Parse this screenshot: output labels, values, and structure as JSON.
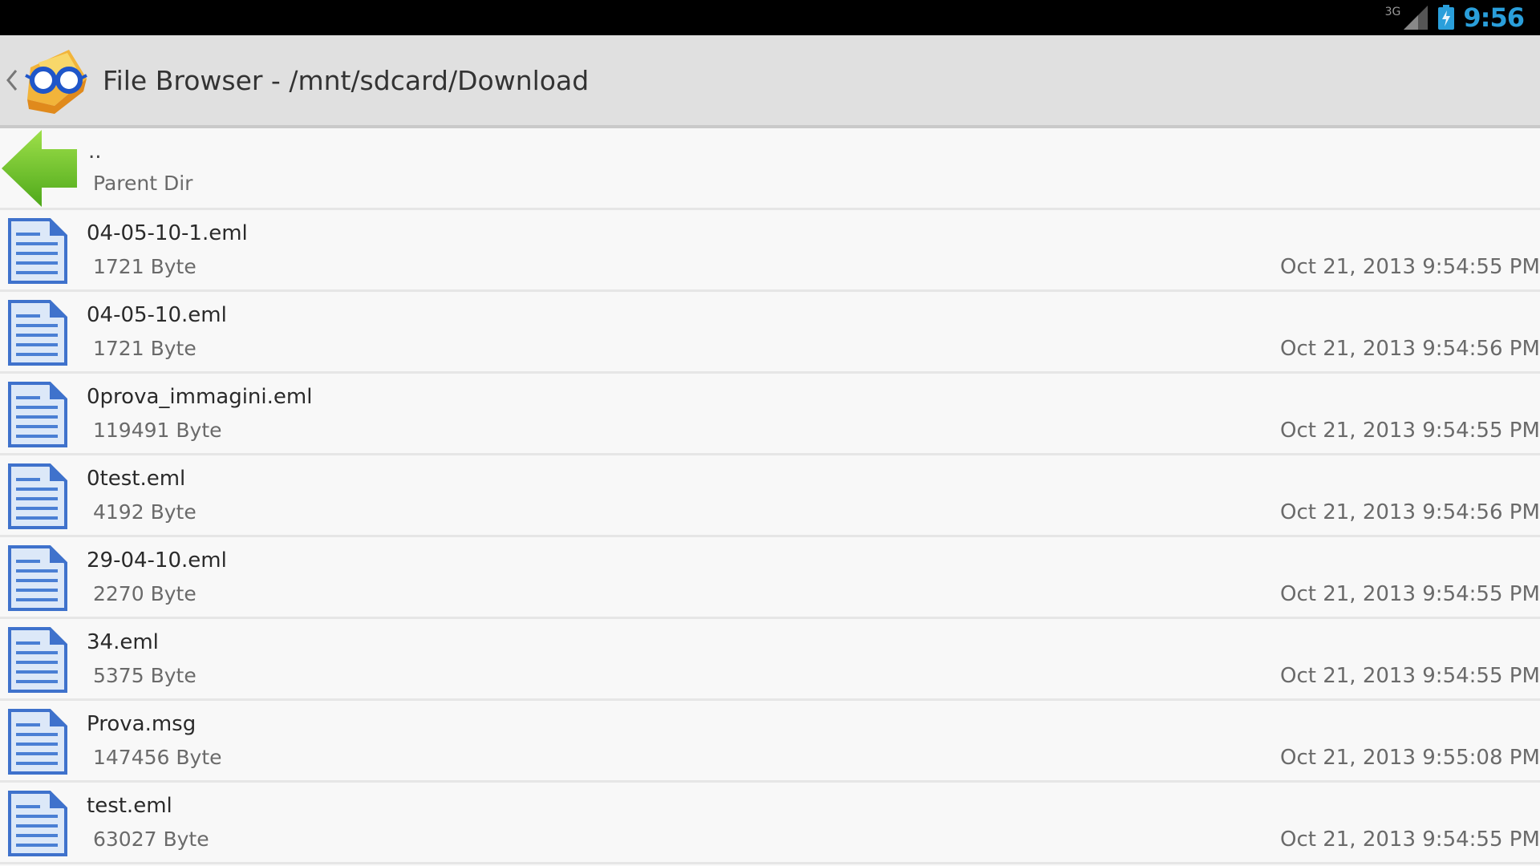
{
  "status_bar": {
    "network": "3G",
    "time": "9:56",
    "clock_color": "#2a9fdb"
  },
  "action_bar": {
    "title": "File Browser - /mnt/sdcard/Download"
  },
  "parent_dir": {
    "name": "..",
    "label": "Parent Dir"
  },
  "files": [
    {
      "name": "04-05-10-1.eml",
      "size": "1721 Byte",
      "modified": "Oct 21, 2013 9:54:55 PM"
    },
    {
      "name": "04-05-10.eml",
      "size": "1721 Byte",
      "modified": "Oct 21, 2013 9:54:56 PM"
    },
    {
      "name": "0prova_immagini.eml",
      "size": "119491 Byte",
      "modified": "Oct 21, 2013 9:54:55 PM"
    },
    {
      "name": "0test.eml",
      "size": "4192 Byte",
      "modified": "Oct 21, 2013 9:54:56 PM"
    },
    {
      "name": "29-04-10.eml",
      "size": "2270 Byte",
      "modified": "Oct 21, 2013 9:54:55 PM"
    },
    {
      "name": "34.eml",
      "size": "5375 Byte",
      "modified": "Oct 21, 2013 9:54:55 PM"
    },
    {
      "name": "Prova.msg",
      "size": "147456 Byte",
      "modified": "Oct 21, 2013 9:55:08 PM"
    },
    {
      "name": "test.eml",
      "size": "63027 Byte",
      "modified": "Oct 21, 2013 9:54:55 PM"
    }
  ],
  "colors": {
    "accent": "#2a9fdb",
    "file_icon_blue": "#4a7fd4",
    "parent_arrow_green": "#6cc22a"
  }
}
